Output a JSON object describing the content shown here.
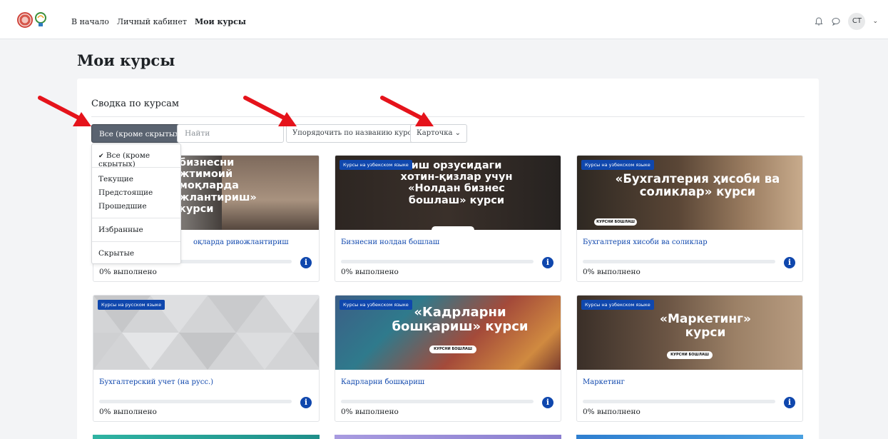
{
  "nav": {
    "links": [
      "В начало",
      "Личный кабинет",
      "Мои курсы"
    ],
    "avatar": "СТ"
  },
  "page": {
    "title": "Мои курсы"
  },
  "overview": {
    "title": "Сводка по курсам",
    "grouping_label": "Все (кроме скрытых)",
    "search_placeholder": "Найти",
    "sort_label": "Упорядочить по названию курса",
    "view_label": "Карточка"
  },
  "grouping_menu": {
    "selected_mark": "✔",
    "items": [
      "Все (кроме скрытых)",
      "Текущие",
      "Предстоящие",
      "Прошедшие",
      "Избранные",
      "Скрытые"
    ]
  },
  "courses": [
    {
      "badge": "",
      "image_text": "бизнесни\nжтимоий\nмоқларда\nжлантириш»\nкурси",
      "title": "оқларда ривожлантириш",
      "progress_label": "0% выполнено",
      "progress": 0
    },
    {
      "badge": "Курсы на узбекском языке",
      "image_text": "иш орзусидаги\nхотин-қизлар учун\n«Нолдан бизнес\nбошлаш» курси",
      "title": "Бизнесни нолдан бошлаш",
      "progress_label": "0% выполнено",
      "progress": 0
    },
    {
      "badge": "Курсы на узбекском языке",
      "image_text": "«Бухгалтерия ҳисоби ва\nсоликлар» курси",
      "pill": "КУРСНИ БОШЛАШ",
      "title": "Бухгалтерия хисоби ва соликлар",
      "progress_label": "0% выполнено",
      "progress": 0
    },
    {
      "badge": "Курсы на русском языке",
      "image_text": "",
      "title": "Бухгалтерский учет (на русс.)",
      "progress_label": "0% выполнено",
      "progress": 0
    },
    {
      "badge": "Курсы на узбекском языке",
      "image_text": "«Кадрларни\nбошқариш» курси",
      "pill": "КУРСНИ БОШЛАШ",
      "title": "Кадрларни бошқариш",
      "progress_label": "0% выполнено",
      "progress": 0
    },
    {
      "badge": "Курсы на узбекском языке",
      "image_text": "«Маркетинг»\nкурси",
      "pill": "КУРСНИ БОШЛАШ",
      "title": "Маркетинг",
      "progress_label": "0% выполнено",
      "progress": 0
    }
  ],
  "colors": {
    "accent": "#0f47ad",
    "grouping_button": "#5a6370",
    "arrow": "#e5131b"
  }
}
